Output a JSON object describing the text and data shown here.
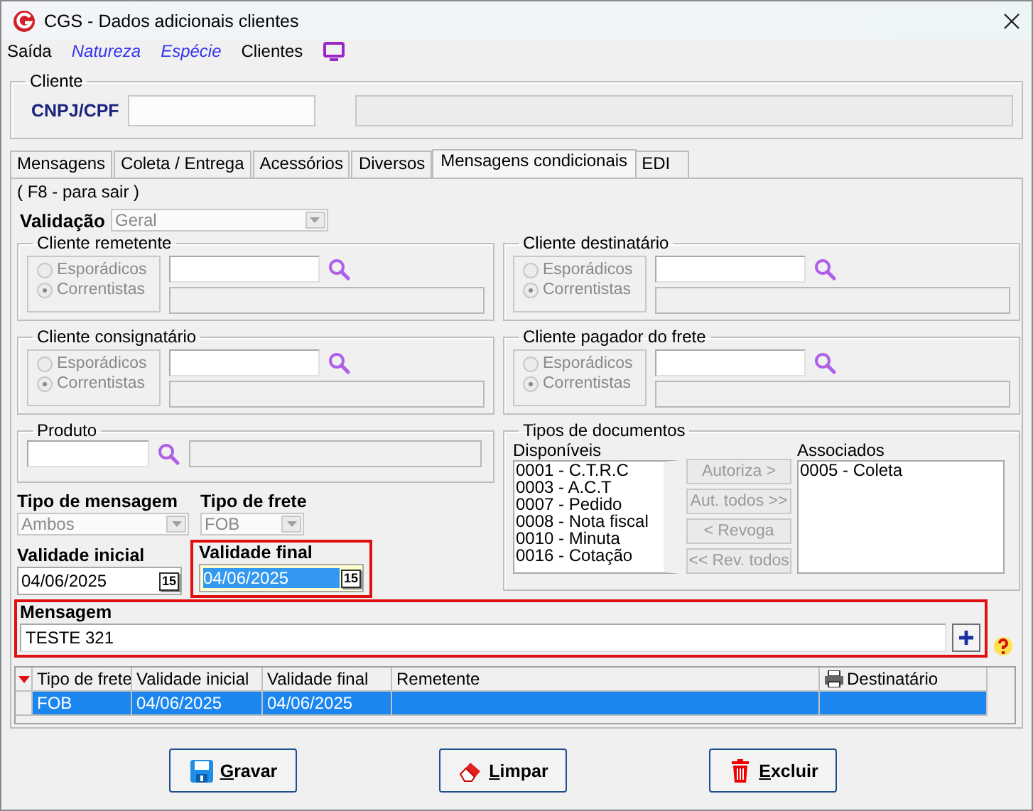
{
  "window": {
    "title": "CGS - Dados adicionais clientes"
  },
  "menu": [
    {
      "label": "Saída",
      "kind": "plain"
    },
    {
      "label": "Natureza",
      "kind": "link"
    },
    {
      "label": "Espécie",
      "kind": "link"
    },
    {
      "label": "Clientes",
      "kind": "plain"
    }
  ],
  "cliente": {
    "title": "Cliente",
    "label": "CNPJ/CPF"
  },
  "tabs": [
    {
      "label": "Mensagens",
      "selected": false
    },
    {
      "label": "Coleta / Entrega",
      "selected": false
    },
    {
      "label": "Acessórios",
      "selected": false
    },
    {
      "label": "Diversos",
      "selected": false
    },
    {
      "label": "Mensagens condicionais",
      "selected": true
    },
    {
      "label": "EDI",
      "selected": false
    }
  ],
  "panel": {
    "hint": "( F8 - para sair )",
    "validacao": {
      "label": "Validação",
      "value": "Geral",
      "disabled": true
    },
    "client_groups": [
      {
        "title": "Cliente remetente",
        "disabled": true,
        "options": [
          {
            "label": "Esporádicos",
            "selected": false
          },
          {
            "label": "Correntistas",
            "selected": true
          }
        ]
      },
      {
        "title": "Cliente destinatário",
        "disabled": true,
        "options": [
          {
            "label": "Esporádicos",
            "selected": false
          },
          {
            "label": "Correntistas",
            "selected": true
          }
        ]
      },
      {
        "title": "Cliente consignatário",
        "disabled": true,
        "options": [
          {
            "label": "Esporádicos",
            "selected": false
          },
          {
            "label": "Correntistas",
            "selected": true
          }
        ]
      },
      {
        "title": "Cliente pagador do frete",
        "disabled": true,
        "options": [
          {
            "label": "Esporádicos",
            "selected": false
          },
          {
            "label": "Correntistas",
            "selected": true
          }
        ]
      }
    ],
    "produto": {
      "title": "Produto"
    },
    "tipo_mensagem": {
      "label": "Tipo de mensagem",
      "value": "Ambos",
      "disabled": true
    },
    "tipo_frete": {
      "label": "Tipo de frete",
      "value": "FOB",
      "disabled": true
    },
    "validade_inicial": {
      "label": "Validade inicial",
      "value": "04/06/2025",
      "calendar": "15",
      "focused": false
    },
    "validade_final": {
      "label": "Validade final",
      "value": "04/06/2025",
      "calendar": "15",
      "focused": true,
      "highlighted": true
    },
    "mensagem": {
      "label": "Mensagem",
      "value": "TESTE 321",
      "highlighted": true
    },
    "documentos": {
      "title": "Tipos de documentos",
      "available_label": "Disponíveis",
      "available": [
        "0001 - C.T.R.C",
        "0003 - A.C.T",
        "0007 - Pedido",
        "0008 - Nota fiscal",
        "0010 - Minuta",
        "0016 - Cotação"
      ],
      "associated_label": "Associados",
      "associated": [
        "0005 - Coleta"
      ],
      "buttons": [
        {
          "label": "Autoriza >",
          "disabled": true
        },
        {
          "label": "Aut. todos >>",
          "disabled": true
        },
        {
          "label": "< Revoga",
          "disabled": true
        },
        {
          "label": "<< Rev. todos",
          "disabled": true
        }
      ]
    }
  },
  "grid": {
    "columns": [
      "Tipo de frete",
      "Validade inicial",
      "Validade final",
      "Remetente",
      "Destinatário"
    ],
    "rows": [
      {
        "cells": [
          "FOB",
          "04/06/2025",
          "04/06/2025",
          "",
          ""
        ],
        "selected": true
      }
    ]
  },
  "buttons": [
    {
      "label": "Gravar",
      "kind": "save"
    },
    {
      "label": "Limpar",
      "kind": "clear"
    },
    {
      "label": "Excluir",
      "kind": "delete"
    }
  ]
}
